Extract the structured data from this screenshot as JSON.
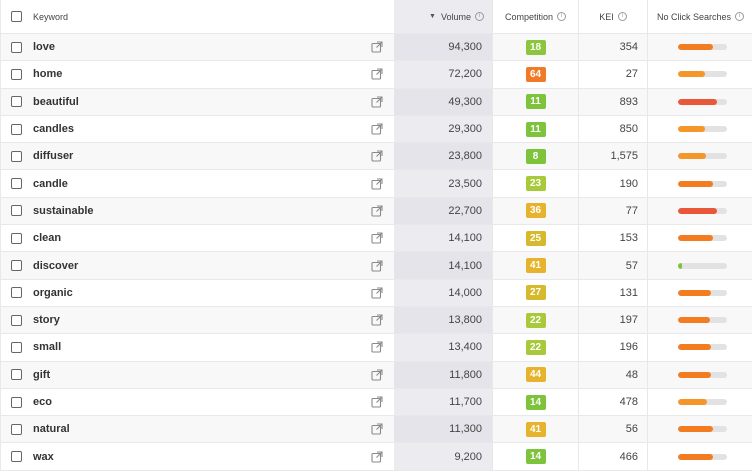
{
  "header": {
    "keyword": "Keyword",
    "volume": "Volume",
    "competition": "Competition",
    "kei": "KEI",
    "no_click": "No Click Searches"
  },
  "rows": [
    {
      "keyword": "love",
      "volume": "94,300",
      "competition": "18",
      "comp_color": "#8cc63e",
      "kei": "354",
      "ncs_fraction": 0.72,
      "ncs_color": "#f47c20"
    },
    {
      "keyword": "home",
      "volume": "72,200",
      "competition": "64",
      "comp_color": "#f07a28",
      "kei": "27",
      "ncs_fraction": 0.55,
      "ncs_color": "#f4962a"
    },
    {
      "keyword": "beautiful",
      "volume": "49,300",
      "competition": "11",
      "comp_color": "#7ec33c",
      "kei": "893",
      "ncs_fraction": 0.8,
      "ncs_color": "#e9573a"
    },
    {
      "keyword": "candles",
      "volume": "29,300",
      "competition": "11",
      "comp_color": "#7ec33c",
      "kei": "850",
      "ncs_fraction": 0.55,
      "ncs_color": "#f4962a"
    },
    {
      "keyword": "diffuser",
      "volume": "23,800",
      "competition": "8",
      "comp_color": "#7ec33c",
      "kei": "1,575",
      "ncs_fraction": 0.58,
      "ncs_color": "#f4962a"
    },
    {
      "keyword": "candle",
      "volume": "23,500",
      "competition": "23",
      "comp_color": "#a8c93a",
      "kei": "190",
      "ncs_fraction": 0.72,
      "ncs_color": "#f47c20"
    },
    {
      "keyword": "sustainable",
      "volume": "22,700",
      "competition": "36",
      "comp_color": "#e8b32c",
      "kei": "77",
      "ncs_fraction": 0.8,
      "ncs_color": "#e9573a"
    },
    {
      "keyword": "clean",
      "volume": "14,100",
      "competition": "25",
      "comp_color": "#d6b92c",
      "kei": "153",
      "ncs_fraction": 0.72,
      "ncs_color": "#f47c20"
    },
    {
      "keyword": "discover",
      "volume": "14,100",
      "competition": "41",
      "comp_color": "#e8b32c",
      "kei": "57",
      "ncs_fraction": 0.08,
      "ncs_color": "#7ec33c"
    },
    {
      "keyword": "organic",
      "volume": "14,000",
      "competition": "27",
      "comp_color": "#d6b92c",
      "kei": "131",
      "ncs_fraction": 0.68,
      "ncs_color": "#f47c20"
    },
    {
      "keyword": "story",
      "volume": "13,800",
      "competition": "22",
      "comp_color": "#a8c93a",
      "kei": "197",
      "ncs_fraction": 0.66,
      "ncs_color": "#f47c20"
    },
    {
      "keyword": "small",
      "volume": "13,400",
      "competition": "22",
      "comp_color": "#a8c93a",
      "kei": "196",
      "ncs_fraction": 0.68,
      "ncs_color": "#f47c20"
    },
    {
      "keyword": "gift",
      "volume": "11,800",
      "competition": "44",
      "comp_color": "#e8b32c",
      "kei": "48",
      "ncs_fraction": 0.68,
      "ncs_color": "#f47c20"
    },
    {
      "keyword": "eco",
      "volume": "11,700",
      "competition": "14",
      "comp_color": "#7ec33c",
      "kei": "478",
      "ncs_fraction": 0.6,
      "ncs_color": "#f4962a"
    },
    {
      "keyword": "natural",
      "volume": "11,300",
      "competition": "41",
      "comp_color": "#e8b32c",
      "kei": "56",
      "ncs_fraction": 0.72,
      "ncs_color": "#f47c20"
    },
    {
      "keyword": "wax",
      "volume": "9,200",
      "competition": "14",
      "comp_color": "#7ec33c",
      "kei": "466",
      "ncs_fraction": 0.72,
      "ncs_color": "#f47c20"
    }
  ]
}
